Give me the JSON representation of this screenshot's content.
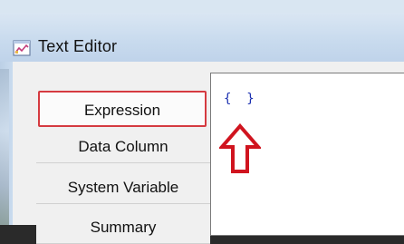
{
  "window": {
    "title": "Text Editor"
  },
  "tabs": [
    {
      "label": "Expression",
      "active": true
    },
    {
      "label": "Data Column",
      "active": false
    },
    {
      "label": "System Variable",
      "active": false
    },
    {
      "label": "Summary",
      "active": false
    }
  ],
  "editor": {
    "value": "{  }"
  },
  "annotation": {
    "arrow_color": "#d0141f",
    "arrow_direction": "up"
  },
  "icons": {
    "title_icon": "document-chart-icon"
  },
  "colors": {
    "active_tab_border": "#d53a40",
    "titlebar": "#c9dbee",
    "editor_text": "#1a2fb0"
  }
}
